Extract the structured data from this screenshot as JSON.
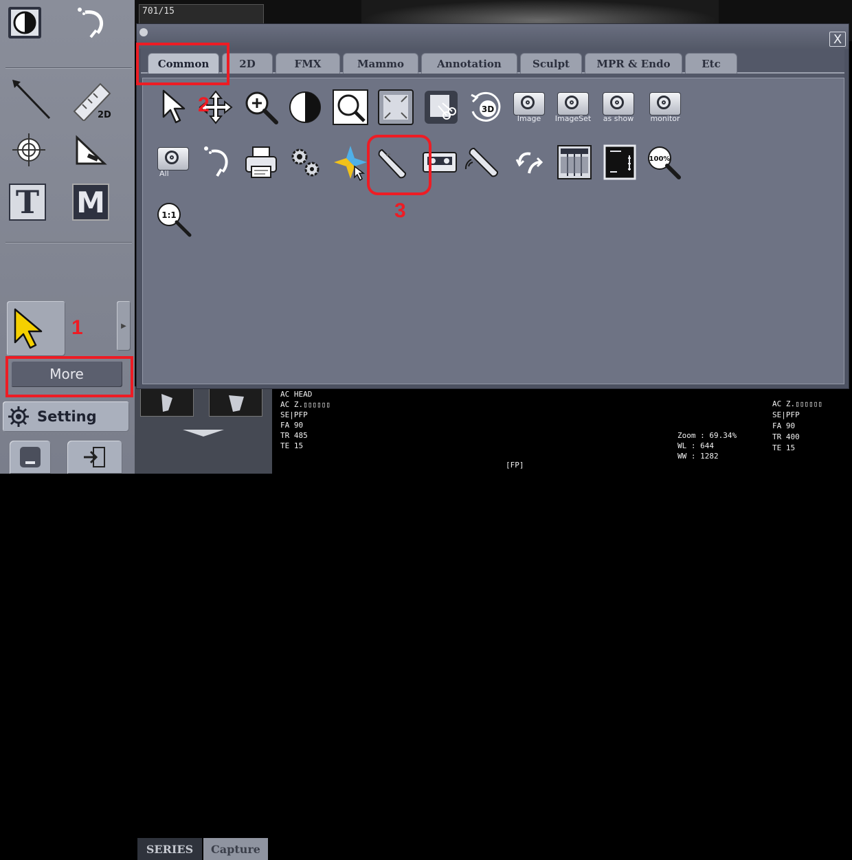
{
  "toolbar": {
    "more_label": "More",
    "setting_label": "Setting"
  },
  "viewer": {
    "image_id_fragment": "701/15",
    "tabs": [
      "SERIES",
      "Capture"
    ],
    "overlay_left": [
      "AC HEAD",
      "AC Z.▯▯▯▯▯▯",
      "SE|PFP",
      "FA 90",
      "TR 485",
      "TE 15"
    ],
    "overlay_center": "[FP]",
    "overlay_mid": [
      "Zoom : 69.34%",
      "WL : 644",
      "WW : 1282"
    ],
    "overlay_right": [
      "AC Z.▯▯▯▯▯▯",
      "SE|PFP",
      "FA 90",
      "TR 400",
      "TE 15"
    ]
  },
  "dialog": {
    "close_symbol": "X",
    "tabs": [
      {
        "label": "Common",
        "active": true
      },
      {
        "label": "2D",
        "active": false
      },
      {
        "label": "FMX",
        "active": false
      },
      {
        "label": "Mammo",
        "active": false
      },
      {
        "label": "Annotation",
        "active": false
      },
      {
        "label": "Sculpt",
        "active": false
      },
      {
        "label": "MPR & Endo",
        "active": false
      },
      {
        "label": "Etc",
        "active": false
      }
    ],
    "tools": {
      "row1": [
        {
          "icon": "arrow-pointer-icon"
        },
        {
          "icon": "move-arrows-icon"
        },
        {
          "icon": "zoom-in-icon"
        },
        {
          "icon": "contrast-icon"
        },
        {
          "icon": "zoom-region-icon"
        },
        {
          "icon": "fit-screen-icon"
        },
        {
          "icon": "cut-image-icon"
        },
        {
          "icon": "rotate-3d-icon",
          "label": "3D"
        },
        {
          "icon": "camera-image-icon",
          "caption": "Image"
        },
        {
          "icon": "camera-imageset-icon",
          "caption": "ImageSet"
        },
        {
          "icon": "camera-as-show-icon",
          "caption": "as show"
        },
        {
          "icon": "camera-monitor-icon",
          "caption": "monitor"
        }
      ],
      "row2": [
        {
          "icon": "camera-all-icon",
          "caption": "All"
        },
        {
          "icon": "undo-icon"
        },
        {
          "icon": "printer-icon"
        },
        {
          "icon": "gears-icon"
        },
        {
          "icon": "crosshair-pointer-icon"
        },
        {
          "icon": "probe-icon"
        },
        {
          "icon": "cassette-icon"
        },
        {
          "icon": "probe-sound-icon"
        },
        {
          "icon": "swap-arrows-icon"
        },
        {
          "icon": "film-grid-icon"
        },
        {
          "icon": "ruler-frame-icon"
        },
        {
          "icon": "zoom-100-icon",
          "label": "100%"
        }
      ],
      "row3": [
        {
          "icon": "zoom-1to1-icon",
          "label": "1:1"
        }
      ]
    }
  },
  "annotations": {
    "step1": "1",
    "step2": "2",
    "step3": "3",
    "color": "#ee1c24"
  },
  "left_tools": {
    "row1": [
      "half-contrast-icon",
      "undo-icon"
    ],
    "row2": [
      "line-icon",
      "ruler-2d-icon"
    ],
    "row3": [
      "crosshair-icon",
      "angle-icon"
    ],
    "row4_labels": [
      "T",
      "M"
    ],
    "bottom": [
      "minimize-icon",
      "exit-icon"
    ]
  },
  "left_tool_labels": {
    "ruler": "2D"
  }
}
